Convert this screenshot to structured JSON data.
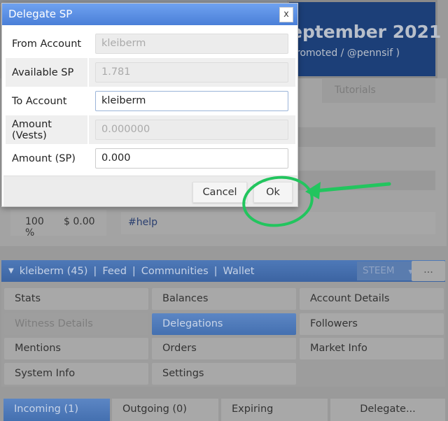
{
  "background": {
    "banner_title": "eptember 2021",
    "banner_subtitle": "romoted / @pennsif )",
    "tab_tutorials": "Tutorials",
    "vote_percent": "100 %",
    "vote_value": "$ 0.00",
    "tag": "#help"
  },
  "nav": {
    "account": "kleiberm (45)",
    "sep": "|",
    "links": [
      "Feed",
      "Communities",
      "Wallet"
    ],
    "chain_select": "STEEM",
    "more": "..."
  },
  "menu": [
    "Stats",
    "Balances",
    "Account Details",
    "Witness Details",
    "Delegations",
    "Followers",
    "Mentions",
    "Orders",
    "Market Info",
    "System Info",
    "Settings"
  ],
  "tabs": [
    "Incoming (1)",
    "Outgoing (0)",
    "Expiring",
    "Delegate..."
  ],
  "dialog": {
    "title": "Delegate SP",
    "close": "x",
    "fields": [
      {
        "label": "From Account",
        "value": "kleiberm"
      },
      {
        "label": "Available SP",
        "value": "1.781"
      },
      {
        "label": "To Account",
        "value": "kleiberm"
      },
      {
        "label": "Amount (Vests)",
        "value": "0.000000"
      },
      {
        "label": "Amount (SP)",
        "value": "0.000"
      }
    ],
    "cancel": "Cancel",
    "ok": "Ok"
  },
  "colors": {
    "accent": "#4a7fd8",
    "annotation": "#22c55e"
  }
}
